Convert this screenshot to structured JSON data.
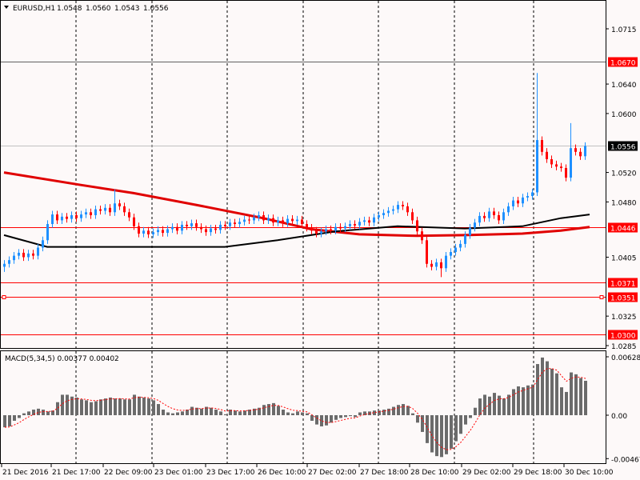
{
  "header": {
    "symbol": "EURUSD,H1",
    "open": "1.0548",
    "high": "1.0560",
    "low": "1.0543",
    "close": "1.0556"
  },
  "price_scale": {
    "ticks": [
      "1.0715",
      "1.0640",
      "1.0600",
      "1.0520",
      "1.0480",
      "1.0405",
      "1.0325",
      "1.0285"
    ]
  },
  "levels": [
    {
      "label": "1.0670",
      "value": 1.067,
      "line": "#606060",
      "box": "#ff0000"
    },
    {
      "label": "1.0556",
      "value": 1.0556,
      "line": "#c0c0c0",
      "box": "#000000"
    },
    {
      "label": "1.0446",
      "value": 1.0446,
      "line": "#ff0000",
      "box": "#ff0000"
    },
    {
      "label": "1.0371",
      "value": 1.0371,
      "line": "#ff0000",
      "box": "#ff0000"
    },
    {
      "label": "1.0351",
      "value": 1.0351,
      "line": "#ff0000",
      "box": "#ff0000"
    },
    {
      "label": "1.0300",
      "value": 1.03,
      "line": "#ff0000",
      "box": "#ff0000"
    }
  ],
  "macd": {
    "label": "MACD(5,34,5) 0.00377 0.00402",
    "ticks": [
      "0.00628",
      "0.00",
      "-0.00467"
    ]
  },
  "time_labels": [
    "21 Dec 2016",
    "21 Dec 17:00",
    "22 Dec 09:00",
    "23 Dec 01:00",
    "23 Dec 17:00",
    "26 Dec 10:00",
    "27 Dec 02:00",
    "27 Dec 18:00",
    "28 Dec 10:00",
    "29 Dec 02:00",
    "29 Dec 18:00",
    "30 Dec 10:00"
  ],
  "colors": {
    "bull": "#1e90ff",
    "bear": "#ff0000",
    "ma_slow": "#e00000",
    "ma_fast": "#000000",
    "hist": "#6b6b6b",
    "signal": "#ff0000"
  },
  "chart_data": {
    "type": "candlestick",
    "title": "EURUSD,H1",
    "ylim": [
      1.0285,
      1.0715
    ],
    "closes": [
      1.0396,
      1.0401,
      1.0407,
      1.0411,
      1.0405,
      1.041,
      1.0407,
      1.0418,
      1.0428,
      1.045,
      1.0463,
      1.0455,
      1.046,
      1.0457,
      1.0462,
      1.0458,
      1.0463,
      1.0466,
      1.0462,
      1.047,
      1.0468,
      1.0472,
      1.0466,
      1.0478,
      1.0474,
      1.0466,
      1.0459,
      1.0447,
      1.0437,
      1.0441,
      1.0436,
      1.0439,
      1.0442,
      1.0438,
      1.0443,
      1.0446,
      1.0441,
      1.0449,
      1.0447,
      1.0451,
      1.0446,
      1.0443,
      1.0439,
      1.0444,
      1.0442,
      1.0449,
      1.0447,
      1.0452,
      1.045,
      1.0453,
      1.0456,
      1.0455,
      1.0459,
      1.0462,
      1.0455,
      1.0458,
      1.0452,
      1.0455,
      1.0451,
      1.0457,
      1.0454,
      1.0456,
      1.045,
      1.0445,
      1.0441,
      1.0437,
      1.044,
      1.0443,
      1.0441,
      1.0446,
      1.0444,
      1.0447,
      1.045,
      1.0448,
      1.0453,
      1.0455,
      1.0452,
      1.0459,
      1.0462,
      1.0465,
      1.0468,
      1.047,
      1.0476,
      1.0474,
      1.0466,
      1.0455,
      1.044,
      1.0428,
      1.0396,
      1.0392,
      1.0398,
      1.039,
      1.0407,
      1.0412,
      1.0418,
      1.0423,
      1.0435,
      1.0445,
      1.0452,
      1.0461,
      1.0458,
      1.0467,
      1.0462,
      1.0455,
      1.0466,
      1.0474,
      1.0482,
      1.0478,
      1.0486,
      1.0488,
      1.0493,
      1.0564,
      1.0548,
      1.0538,
      1.0531,
      1.0528,
      1.0526,
      1.0513,
      1.0553,
      1.0548,
      1.0542,
      1.0556
    ],
    "extreme_highs": {
      "111": 1.0655,
      "118": 1.0587,
      "23": 1.0497
    },
    "extreme_lows": {
      "91": 1.0378,
      "0": 1.0385
    },
    "ma_slow": [
      [
        0,
        1.052
      ],
      [
        16,
        1.0503
      ],
      [
        27,
        1.0492
      ],
      [
        40,
        1.0476
      ],
      [
        54,
        1.0458
      ],
      [
        64,
        1.0443
      ],
      [
        74,
        1.0436
      ],
      [
        86,
        1.0434
      ],
      [
        96,
        1.0435
      ],
      [
        108,
        1.0437
      ],
      [
        116,
        1.0441
      ],
      [
        122,
        1.0446
      ]
    ],
    "ma_fast": [
      [
        0,
        1.0435
      ],
      [
        9,
        1.0419
      ],
      [
        46,
        1.0419
      ],
      [
        57,
        1.0428
      ],
      [
        69,
        1.044
      ],
      [
        82,
        1.0447
      ],
      [
        96,
        1.0444
      ],
      [
        108,
        1.0447
      ],
      [
        116,
        1.0458
      ],
      [
        122,
        1.0463
      ]
    ],
    "macd_ylim": [
      -0.00467,
      0.00628
    ],
    "macd_hist": [
      -0.0013,
      -0.0012,
      -0.0006,
      -0.0003,
      0.0002,
      0.0004,
      0.0006,
      0.0007,
      0.0006,
      0.0004,
      0.0005,
      0.0014,
      0.0022,
      0.0022,
      0.002,
      0.0019,
      0.0017,
      0.0016,
      0.0014,
      0.0015,
      0.0017,
      0.0018,
      0.0019,
      0.0018,
      0.0018,
      0.0017,
      0.0017,
      0.0022,
      0.002,
      0.0019,
      0.0018,
      0.0016,
      0.0012,
      0.0006,
      0.0003,
      0.0002,
      0.0003,
      0.0004,
      0.0006,
      0.0009,
      0.0008,
      0.0007,
      0.0009,
      0.0008,
      0.0006,
      0.0004,
      0.0001,
      0.0006,
      0.0005,
      0.0004,
      0.0005,
      0.0006,
      0.0007,
      0.0008,
      0.0011,
      0.0012,
      0.0013,
      0.001,
      0.0006,
      0.0003,
      0.0002,
      0.0004,
      0.0003,
      0.0002,
      -0.0006,
      -0.001,
      -0.0012,
      -0.0011,
      -0.0008,
      -0.0005,
      -0.0003,
      -0.0002,
      -0.0001,
      -0.0002,
      0.0003,
      0.0004,
      0.0004,
      0.0005,
      0.0005,
      0.0006,
      0.0007,
      0.0009,
      0.0011,
      0.0012,
      0.001,
      0.0002,
      -0.0008,
      -0.0018,
      -0.003,
      -0.004,
      -0.0044,
      -0.0045,
      -0.0042,
      -0.0036,
      -0.0028,
      -0.002,
      -0.001,
      -0.0003,
      0.0008,
      0.0018,
      0.0022,
      0.002,
      0.0024,
      0.0021,
      0.0018,
      0.0022,
      0.0028,
      0.0031,
      0.003,
      0.0032,
      0.0033,
      0.0055,
      0.0062,
      0.0058,
      0.005,
      0.0045,
      0.003,
      0.0025,
      0.0046,
      0.0044,
      0.004,
      0.0037
    ]
  }
}
